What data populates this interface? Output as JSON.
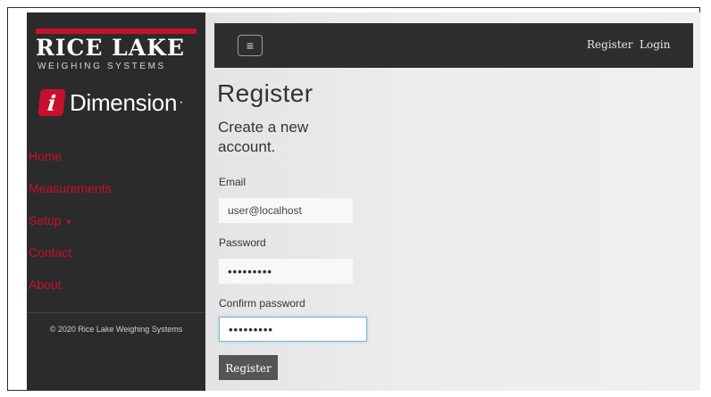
{
  "brand": {
    "logo_main": "RICE LAKE",
    "logo_sub": "WEIGHING SYSTEMS",
    "product_icon": "i",
    "product_name": "Dimension",
    "product_mark": "·"
  },
  "sidebar": {
    "items": [
      {
        "label": "Home"
      },
      {
        "label": "Measurements"
      },
      {
        "label": "Setup",
        "caret": "▾"
      },
      {
        "label": "Contact"
      },
      {
        "label": "About"
      }
    ],
    "copyright": "© 2020 Rice Lake Weighing Systems"
  },
  "navbar": {
    "menu_icon": "≡",
    "register": "Register",
    "login": "Login"
  },
  "page": {
    "title": "Register",
    "subtitle": "Create a new account."
  },
  "form": {
    "email_label": "Email",
    "email_value": "user@localhost",
    "password_label": "Password",
    "password_value": "•••••••••",
    "confirm_label": "Confirm password",
    "confirm_value": "•••••••••",
    "submit": "Register"
  },
  "colors": {
    "accent": "#c8102e",
    "sidebar_bg": "#2b2b2b",
    "navbar_bg": "#2e2e2e",
    "button_bg": "#555555"
  }
}
